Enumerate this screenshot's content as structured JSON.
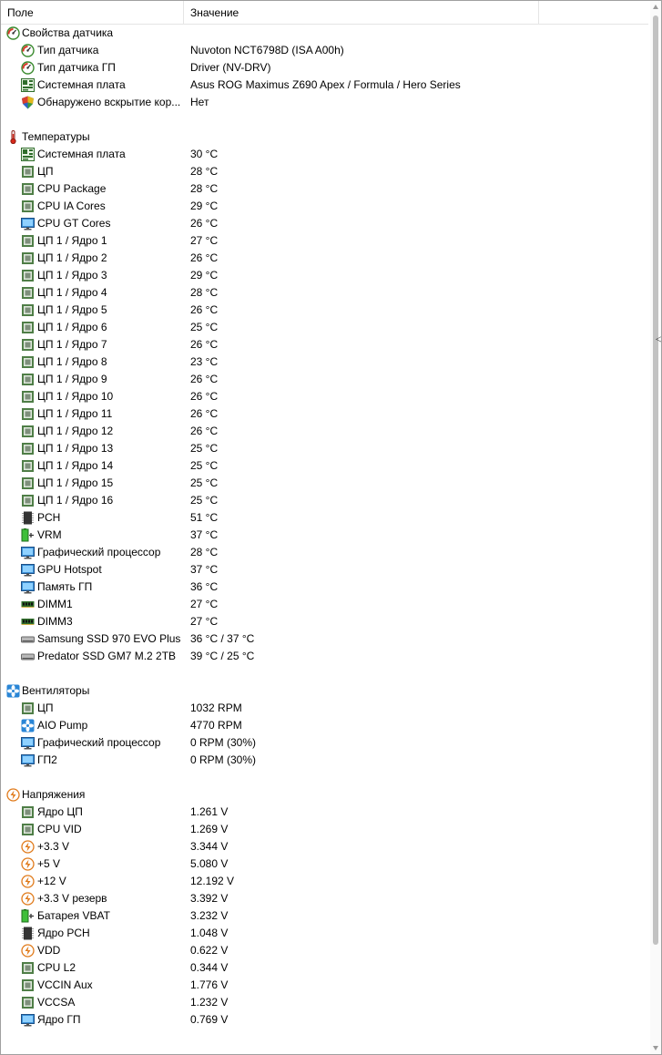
{
  "header": {
    "field": "Поле",
    "value": "Значение"
  },
  "rows": [
    {
      "type": "group",
      "icon": "gauge",
      "field": "Свойства датчика",
      "value": ""
    },
    {
      "type": "item",
      "icon": "gauge",
      "field": "Тип датчика",
      "value": "Nuvoton NCT6798D  (ISA A00h)"
    },
    {
      "type": "item",
      "icon": "gauge",
      "field": "Тип датчика ГП",
      "value": "Driver  (NV-DRV)"
    },
    {
      "type": "item",
      "icon": "mobo",
      "field": "Системная плата",
      "value": "Asus ROG Maximus Z690 Apex / Formula / Hero Series"
    },
    {
      "type": "item",
      "icon": "shield",
      "field": "Обнаружено вскрытие кор...",
      "value": "Нет"
    },
    {
      "type": "spacer"
    },
    {
      "type": "group",
      "icon": "thermo",
      "field": "Температуры",
      "value": ""
    },
    {
      "type": "item",
      "icon": "mobo",
      "field": "Системная плата",
      "value": "30 °C"
    },
    {
      "type": "item",
      "icon": "cpu",
      "field": "ЦП",
      "value": "28 °C"
    },
    {
      "type": "item",
      "icon": "cpu",
      "field": "CPU Package",
      "value": "28 °C"
    },
    {
      "type": "item",
      "icon": "cpu",
      "field": "CPU IA Cores",
      "value": "29 °C"
    },
    {
      "type": "item",
      "icon": "monitor",
      "field": "CPU GT Cores",
      "value": "26 °C"
    },
    {
      "type": "item",
      "icon": "cpu",
      "field": "ЦП 1 / Ядро 1",
      "value": "27 °C"
    },
    {
      "type": "item",
      "icon": "cpu",
      "field": "ЦП 1 / Ядро 2",
      "value": "26 °C"
    },
    {
      "type": "item",
      "icon": "cpu",
      "field": "ЦП 1 / Ядро 3",
      "value": "29 °C"
    },
    {
      "type": "item",
      "icon": "cpu",
      "field": "ЦП 1 / Ядро 4",
      "value": "28 °C"
    },
    {
      "type": "item",
      "icon": "cpu",
      "field": "ЦП 1 / Ядро 5",
      "value": "26 °C"
    },
    {
      "type": "item",
      "icon": "cpu",
      "field": "ЦП 1 / Ядро 6",
      "value": "25 °C"
    },
    {
      "type": "item",
      "icon": "cpu",
      "field": "ЦП 1 / Ядро 7",
      "value": "26 °C"
    },
    {
      "type": "item",
      "icon": "cpu",
      "field": "ЦП 1 / Ядро 8",
      "value": "23 °C"
    },
    {
      "type": "item",
      "icon": "cpu",
      "field": "ЦП 1 / Ядро 9",
      "value": "26 °C"
    },
    {
      "type": "item",
      "icon": "cpu",
      "field": "ЦП 1 / Ядро 10",
      "value": "26 °C"
    },
    {
      "type": "item",
      "icon": "cpu",
      "field": "ЦП 1 / Ядро 11",
      "value": "26 °C"
    },
    {
      "type": "item",
      "icon": "cpu",
      "field": "ЦП 1 / Ядро 12",
      "value": "26 °C"
    },
    {
      "type": "item",
      "icon": "cpu",
      "field": "ЦП 1 / Ядро 13",
      "value": "25 °C"
    },
    {
      "type": "item",
      "icon": "cpu",
      "field": "ЦП 1 / Ядро 14",
      "value": "25 °C"
    },
    {
      "type": "item",
      "icon": "cpu",
      "field": "ЦП 1 / Ядро 15",
      "value": "25 °C"
    },
    {
      "type": "item",
      "icon": "cpu",
      "field": "ЦП 1 / Ядро 16",
      "value": "25 °C"
    },
    {
      "type": "item",
      "icon": "chip",
      "field": "PCH",
      "value": "51 °C"
    },
    {
      "type": "item",
      "icon": "battery",
      "field": "VRM",
      "value": "37 °C"
    },
    {
      "type": "item",
      "icon": "monitor",
      "field": "Графический процессор",
      "value": "28 °C"
    },
    {
      "type": "item",
      "icon": "monitor",
      "field": "GPU Hotspot",
      "value": "37 °C"
    },
    {
      "type": "item",
      "icon": "monitor",
      "field": "Память ГП",
      "value": "36 °C"
    },
    {
      "type": "item",
      "icon": "ram",
      "field": "DIMM1",
      "value": "27 °C"
    },
    {
      "type": "item",
      "icon": "ram",
      "field": "DIMM3",
      "value": "27 °C"
    },
    {
      "type": "item",
      "icon": "disk",
      "field": "Samsung SSD 970 EVO Plus ...",
      "value": "36 °C / 37 °C"
    },
    {
      "type": "item",
      "icon": "disk",
      "field": "Predator SSD GM7 M.2 2TB",
      "value": "39 °C / 25 °C"
    },
    {
      "type": "spacer"
    },
    {
      "type": "group",
      "icon": "fan",
      "field": "Вентиляторы",
      "value": ""
    },
    {
      "type": "item",
      "icon": "cpu",
      "field": "ЦП",
      "value": "1032 RPM"
    },
    {
      "type": "item",
      "icon": "fan",
      "field": "AIO Pump",
      "value": "4770 RPM"
    },
    {
      "type": "item",
      "icon": "monitor",
      "field": "Графический процессор",
      "value": "0 RPM  (30%)"
    },
    {
      "type": "item",
      "icon": "monitor",
      "field": "ГП2",
      "value": "0 RPM  (30%)"
    },
    {
      "type": "spacer"
    },
    {
      "type": "group",
      "icon": "bolt",
      "field": "Напряжения",
      "value": ""
    },
    {
      "type": "item",
      "icon": "cpu",
      "field": "Ядро ЦП",
      "value": "1.261 V"
    },
    {
      "type": "item",
      "icon": "cpu",
      "field": "CPU VID",
      "value": "1.269 V"
    },
    {
      "type": "item",
      "icon": "bolt",
      "field": "+3.3 V",
      "value": "3.344 V"
    },
    {
      "type": "item",
      "icon": "bolt",
      "field": "+5 V",
      "value": "5.080 V"
    },
    {
      "type": "item",
      "icon": "bolt",
      "field": "+12 V",
      "value": "12.192 V"
    },
    {
      "type": "item",
      "icon": "bolt",
      "field": "+3.3 V резерв",
      "value": "3.392 V"
    },
    {
      "type": "item",
      "icon": "battery",
      "field": "Батарея VBAT",
      "value": "3.232 V"
    },
    {
      "type": "item",
      "icon": "chip",
      "field": "Ядро PCH",
      "value": "1.048 V"
    },
    {
      "type": "item",
      "icon": "bolt",
      "field": "VDD",
      "value": "0.622 V"
    },
    {
      "type": "item",
      "icon": "cpu",
      "field": "CPU L2",
      "value": "0.344 V"
    },
    {
      "type": "item",
      "icon": "cpu",
      "field": "VCCIN Aux",
      "value": "1.776 V"
    },
    {
      "type": "item",
      "icon": "cpu",
      "field": "VCCSA",
      "value": "1.232 V"
    },
    {
      "type": "item",
      "icon": "monitor",
      "field": "Ядро ГП",
      "value": "0.769 V"
    }
  ],
  "colors": {
    "grid": "#e5e5e5",
    "border": "#a0a0a0",
    "scroll_thumb": "#c1c1c1"
  }
}
